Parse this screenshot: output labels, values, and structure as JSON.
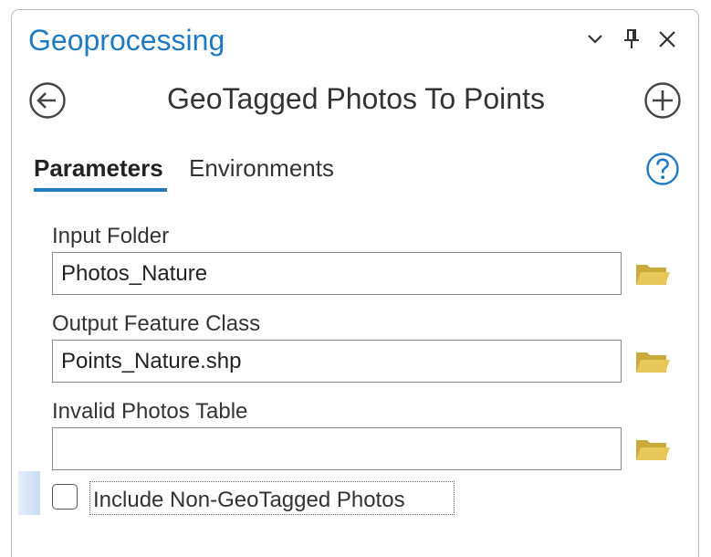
{
  "pane": {
    "title": "Geoprocessing",
    "controls": {
      "options_icon": "chevron-down-icon",
      "pin_icon": "pin-icon",
      "close_icon": "close-icon"
    }
  },
  "tool": {
    "title": "GeoTagged Photos To Points",
    "back_icon": "back-arrow-icon",
    "add_icon": "add-circle-icon"
  },
  "tabs": [
    {
      "label": "Parameters",
      "active": true
    },
    {
      "label": "Environments",
      "active": false
    }
  ],
  "help_icon": "help-icon",
  "accent_color": "#1f7ac2",
  "folder_color": "#d8b844",
  "parameters": [
    {
      "label": "Input Folder",
      "value": "Photos_Nature"
    },
    {
      "label": "Output Feature Class",
      "value": "Points_Nature.shp"
    },
    {
      "label": "Invalid Photos Table",
      "value": ""
    }
  ],
  "include_option": {
    "label": "Include Non-GeoTagged Photos",
    "checked": false
  }
}
